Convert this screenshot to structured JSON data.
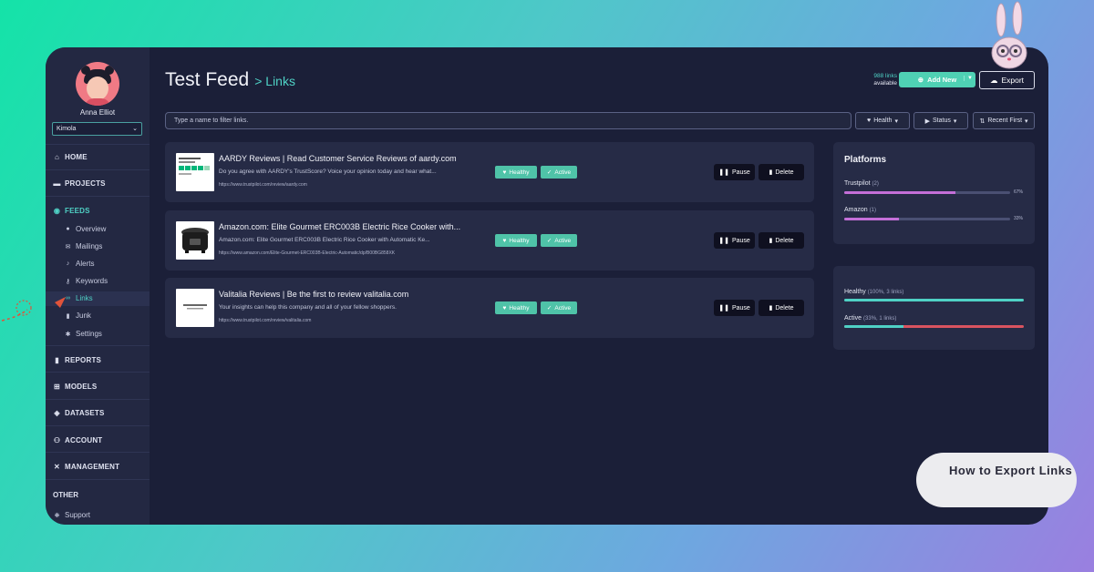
{
  "user": {
    "name": "Anna Elliot",
    "org": "Kimola"
  },
  "nav": {
    "home": "HOME",
    "projects": "PROJECTS",
    "feeds": "FEEDS",
    "feeds_sub": [
      "Overview",
      "Mailings",
      "Alerts",
      "Keywords",
      "Links",
      "Junk",
      "Settings"
    ],
    "reports": "REPORTS",
    "models": "MODELS",
    "datasets": "DATASETS",
    "account": "ACCOUNT",
    "management": "MANAGEMENT",
    "other": "OTHER",
    "support": "Support"
  },
  "header": {
    "title": "Test Feed",
    "crumb": "> Links",
    "links_count": "988 links",
    "available": "available",
    "add_new": "Add New",
    "export": "Export"
  },
  "filter": {
    "placeholder": "Type a name to filter links.",
    "health": "Health",
    "status": "Status",
    "sort": "Recent First"
  },
  "links": [
    {
      "title": "AARDY Reviews | Read Customer Service Reviews of aardy.com",
      "desc": "Do you agree with AARDY's TrustScore? Voice your opinion today and hear what...",
      "url": "https://www.trustpilot.com/review/aardy.com",
      "health": "Healthy",
      "status": "Active",
      "pause": "Pause",
      "delete": "Delete",
      "thumb": "trustpilot"
    },
    {
      "title": "Amazon.com: Elite Gourmet ERC003B Electric Rice Cooker with...",
      "desc": "Amazon.com: Elite Gourmet ERC003B Electric Rice Cooker with Automatic Ke...",
      "url": "https://www.amazon.com/Elite-Gourmet-ERC003B-Electric-Automatic/dp/B00BG858XK",
      "health": "Healthy",
      "status": "Active",
      "pause": "Pause",
      "delete": "Delete",
      "thumb": "rice-cooker"
    },
    {
      "title": "Valitalia Reviews | Be the first to review valitalia.com",
      "desc": "Your insights can help this company and all of your fellow shoppers.",
      "url": "https://www.trustpilot.com/review/valitalia.com",
      "health": "Healthy",
      "status": "Active",
      "pause": "Pause",
      "delete": "Delete",
      "thumb": "review-page"
    }
  ],
  "platforms": {
    "title": "Platforms",
    "items": [
      {
        "name": "Trustpilot",
        "count": "(2)",
        "pct": "67%",
        "value": 0.67,
        "color": "#c46fd8"
      },
      {
        "name": "Amazon",
        "count": "(1)",
        "pct": "33%",
        "value": 0.33,
        "color": "#c46fd8"
      }
    ]
  },
  "summary": {
    "items": [
      {
        "name": "Healthy",
        "detail": "(100%, 3 links)",
        "value": 1.0,
        "color": "#4fd1c5"
      },
      {
        "name": "Active",
        "detail": "(33%, 1 links)",
        "value": 0.33,
        "color": "#4fd1c5",
        "rest_color": "#d9535f"
      }
    ]
  },
  "help_label": "How to Export Links"
}
